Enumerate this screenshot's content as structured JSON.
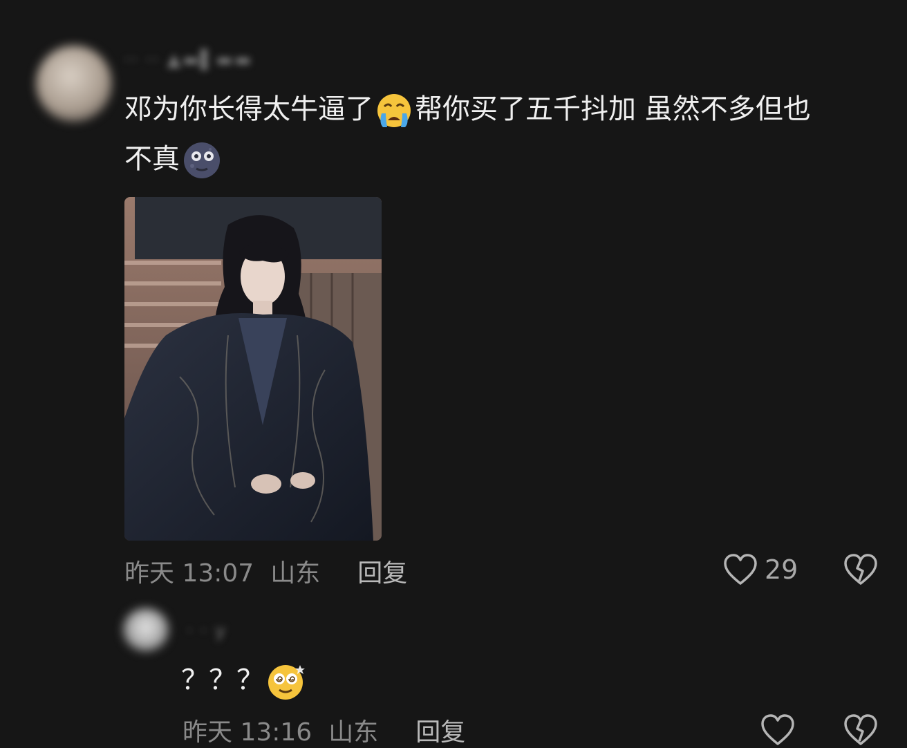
{
  "comments": [
    {
      "username": "·· ·· ▲▬▌▬▬",
      "text_line1": "邓为你长得太牛逼了",
      "text_line1b": "帮你买了五千抖加 虽然不多但也",
      "text_line2": "不真",
      "emoji_1": "loudly-crying-face",
      "emoji_2": "new-moon-face",
      "time": "昨天 13:07",
      "location": "山东",
      "reply_label": "回复",
      "like_count": "29"
    },
    {
      "username": "· · y",
      "text": "？？？",
      "emoji": "dizzy-eyes-face",
      "time": "昨天 13:16",
      "location": "山东",
      "reply_label": "回复"
    }
  ],
  "colors": {
    "background": "#161616",
    "text": "#f0f0f0",
    "meta": "#8a8a8a"
  }
}
